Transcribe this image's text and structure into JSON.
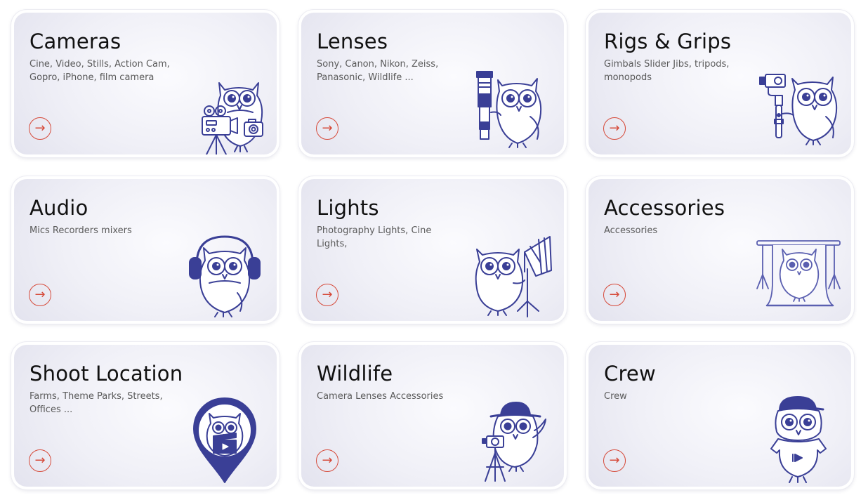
{
  "accent_color": "#d64a3a",
  "illustration_color": "#3a3f96",
  "categories": [
    {
      "title": "Cameras",
      "description": "Cine, Video, Stills, Action Cam, Gopro, iPhone, film camera",
      "arrow": "→",
      "icon": "owl-camera-icon"
    },
    {
      "title": "Lenses",
      "description": "Sony, Canon, Nikon, Zeiss, Panasonic, Wildlife ...",
      "arrow": "→",
      "icon": "owl-lens-icon"
    },
    {
      "title": "Rigs & Grips",
      "description": "Gimbals Slider Jibs, tripods, monopods",
      "arrow": "→",
      "icon": "owl-gimbal-icon"
    },
    {
      "title": "Audio",
      "description": "Mics Recorders mixers",
      "arrow": "→",
      "icon": "owl-headphones-icon"
    },
    {
      "title": "Lights",
      "description": "Photography Lights, Cine Lights,",
      "arrow": "→",
      "icon": "owl-softbox-icon"
    },
    {
      "title": "Accessories",
      "description": "Accessories",
      "arrow": "→",
      "icon": "owl-backdrop-icon"
    },
    {
      "title": "Shoot Location",
      "description": "Farms, Theme Parks, Streets, Offices ...",
      "arrow": "→",
      "icon": "owl-location-pin-icon"
    },
    {
      "title": "Wildlife",
      "description": "Camera Lenses Accessories",
      "arrow": "→",
      "icon": "owl-explorer-icon"
    },
    {
      "title": "Crew",
      "description": "Crew",
      "arrow": "→",
      "icon": "owl-crew-icon"
    }
  ]
}
